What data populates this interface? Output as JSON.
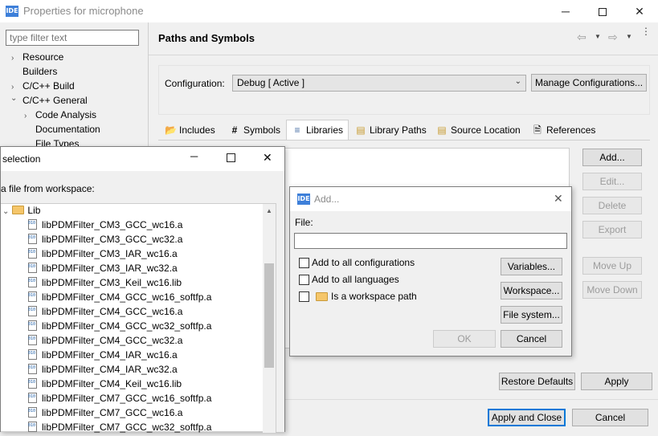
{
  "window": {
    "title": "Properties for microphone",
    "logo": "IDE",
    "controls": [
      "minimize-icon",
      "maximize-icon",
      "close-icon"
    ]
  },
  "sidebar": {
    "filter_placeholder": "type filter text",
    "items": [
      {
        "label": "Resource",
        "chevron": "›"
      },
      {
        "label": "Builders",
        "chevron": ""
      },
      {
        "label": "C/C++ Build",
        "chevron": "›"
      },
      {
        "label": "C/C++ General",
        "chevron": "⌄"
      },
      {
        "label": "Code Analysis",
        "chevron": "›"
      },
      {
        "label": "Documentation",
        "chevron": ""
      },
      {
        "label": "File Types",
        "chevron": ""
      }
    ]
  },
  "main": {
    "heading": "Paths and Symbols",
    "nav_icons": [
      "back-icon",
      "dropdown-icon",
      "forward-icon",
      "dropdown-icon",
      "more-icon"
    ],
    "configuration_label": "Configuration:",
    "configuration_value": "Debug  [ Active ]",
    "manage_button": "Manage Configurations...",
    "tabs": [
      {
        "label": "Includes",
        "icon": "includes-icon"
      },
      {
        "label": "Symbols",
        "icon": "hash-icon"
      },
      {
        "label": "Libraries",
        "icon": "libraries-icon"
      },
      {
        "label": "Library Paths",
        "icon": "library-paths-icon"
      },
      {
        "label": "Source Location",
        "icon": "source-location-icon"
      },
      {
        "label": "References",
        "icon": "references-icon"
      }
    ],
    "active_tab": "Libraries",
    "side_buttons": [
      "Add...",
      "Edit...",
      "Delete",
      "Export",
      "Move Up",
      "Move Down"
    ],
    "restore_defaults": "Restore Defaults",
    "apply": "Apply",
    "apply_close": "Apply and Close",
    "cancel": "Cancel"
  },
  "file_selection": {
    "title": "selection",
    "prompt": "a file from workspace:",
    "folder": "Lib",
    "files": [
      "libPDMFilter_CM3_GCC_wc16.a",
      "libPDMFilter_CM3_GCC_wc32.a",
      "libPDMFilter_CM3_IAR_wc16.a",
      "libPDMFilter_CM3_IAR_wc32.a",
      "libPDMFilter_CM3_Keil_wc16.lib",
      "libPDMFilter_CM4_GCC_wc16_softfp.a",
      "libPDMFilter_CM4_GCC_wc16.a",
      "libPDMFilter_CM4_GCC_wc32_softfp.a",
      "libPDMFilter_CM4_GCC_wc32.a",
      "libPDMFilter_CM4_IAR_wc16.a",
      "libPDMFilter_CM4_IAR_wc32.a",
      "libPDMFilter_CM4_Keil_wc16.lib",
      "libPDMFilter_CM7_GCC_wc16_softfp.a",
      "libPDMFilter_CM7_GCC_wc16.a",
      "libPDMFilter_CM7_GCC_wc32_softfp.a"
    ]
  },
  "add_dialog": {
    "logo": "IDE",
    "title": "Add...",
    "file_label": "File:",
    "file_value": "",
    "checkbox_all_configs": "Add to all configurations",
    "checkbox_all_languages": "Add to all languages",
    "checkbox_workspace": "Is a workspace path",
    "variables_button": "Variables...",
    "workspace_button": "Workspace...",
    "filesystem_button": "File system...",
    "ok_button": "OK",
    "cancel_button": "Cancel"
  }
}
